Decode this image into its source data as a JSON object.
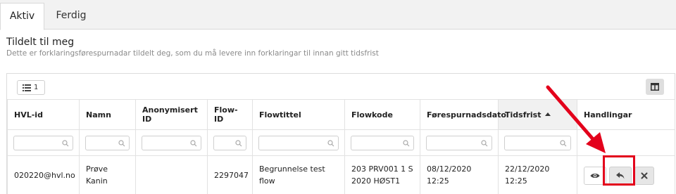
{
  "tabs": [
    {
      "label": "Aktiv",
      "active": true
    },
    {
      "label": "Ferdig",
      "active": false
    }
  ],
  "section": {
    "title": "Tildelt til meg",
    "description": "Dette er forklaringsførespurnadar tildelt deg, som du må levere inn forklaringar til innan gitt tidsfrist"
  },
  "toolbar": {
    "filter_count": "1",
    "filter_icon": "list-icon",
    "columns_icon": "columns-icon"
  },
  "table": {
    "headers": [
      "HVL-id",
      "Namn",
      "Anonymisert ID",
      "Flow-ID",
      "Flowtittel",
      "Flowkode",
      "Førespurnadsdato",
      "Tidsfrist",
      "Handlingar"
    ],
    "sorted_column": "Tidsfrist",
    "sort_direction": "ascending",
    "filter_icon": "search-icon",
    "rows": [
      {
        "hvl_id": "020220@hvl.no",
        "namn": "Prøve Kanin",
        "anonymisert_id": "",
        "flow_id": "2297047",
        "flowtittel": "Begrunnelse test flow",
        "flowkode_line1": "203 PRV001 1 S",
        "flowkode_line2": "2020 HØST1",
        "dato": "08/12/2020 12:25",
        "frist": "22/12/2020 12:25",
        "actions": [
          "eye-icon",
          "reply-icon",
          "close-icon"
        ]
      }
    ]
  },
  "annotation": {
    "color": "#e3001b",
    "highlighted_action": "reply-button"
  }
}
